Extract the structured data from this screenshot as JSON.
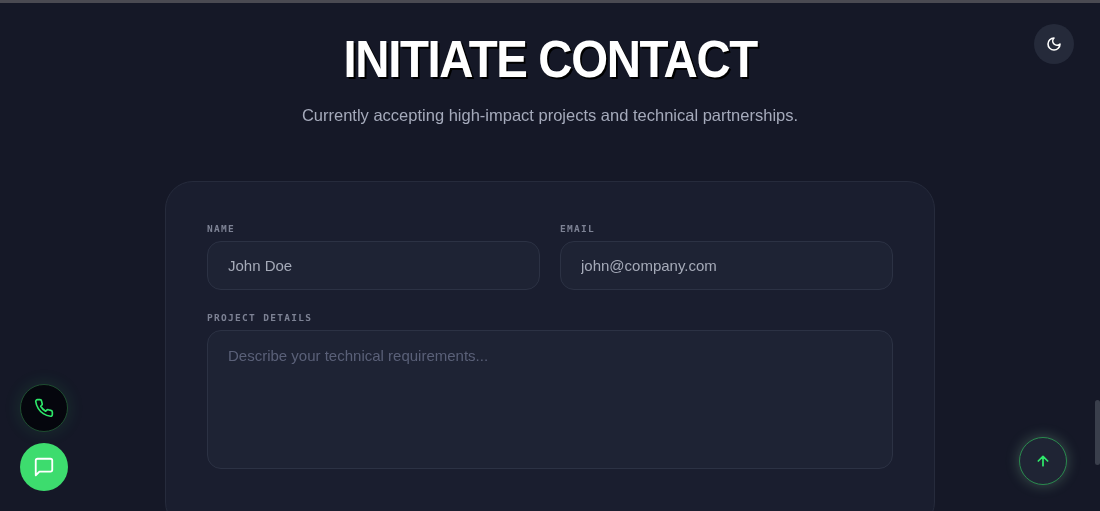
{
  "header": {
    "title": "INITIATE CONTACT",
    "subtitle": "Currently accepting high-impact projects and technical partnerships."
  },
  "form": {
    "fields": [
      {
        "kind": "input",
        "label": "NAME",
        "placeholder": "John Doe"
      },
      {
        "kind": "input",
        "label": "EMAIL",
        "placeholder": "john@company.com"
      },
      {
        "kind": "textarea",
        "label": "PROJECT DETAILS",
        "placeholder": "Describe your technical requirements..."
      }
    ]
  }
}
